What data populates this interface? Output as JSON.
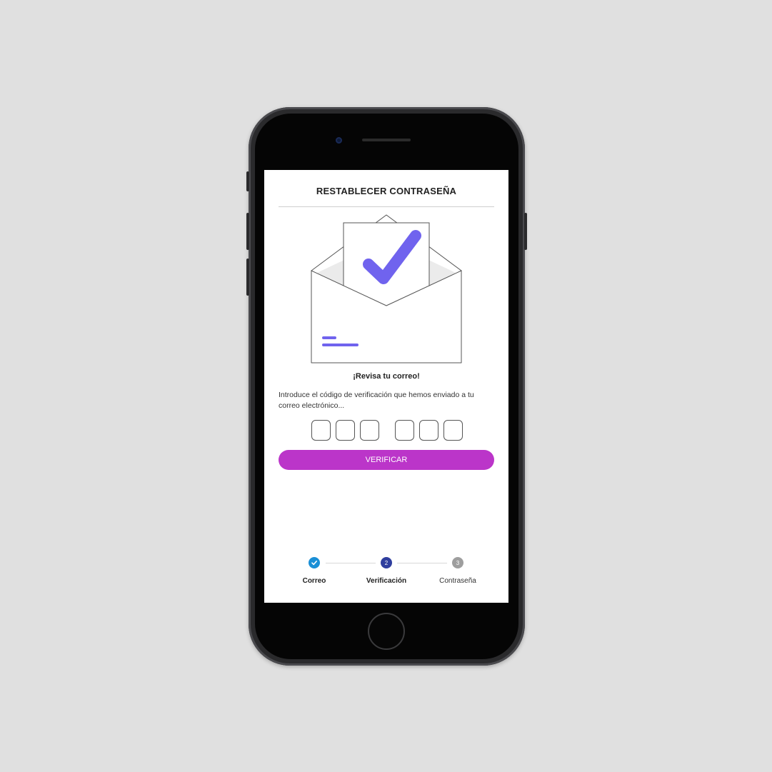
{
  "header": {
    "title": "RESTABLECER CONTRASEÑA"
  },
  "content": {
    "headline": "¡Revisa tu correo!",
    "description": "Introduce el código de verificación que hemos enviado a tu correo electrónico...",
    "code_boxes": [
      "",
      "",
      "",
      "",
      "",
      ""
    ],
    "verify_label": "VERIFICAR"
  },
  "stepper": {
    "steps": [
      {
        "label": "Correo",
        "number": "",
        "state": "completed",
        "icon": "check-icon"
      },
      {
        "label": "Verificación",
        "number": "2",
        "state": "active"
      },
      {
        "label": "Contraseña",
        "number": "3",
        "state": "pending"
      }
    ]
  },
  "colors": {
    "accent": "#bb35c9",
    "check": "#7063ee",
    "step_completed": "#1a8fd6",
    "step_active": "#2f3e9e",
    "step_pending": "#9e9e9e"
  },
  "icons": [
    "envelope-check-illustration",
    "check-icon"
  ]
}
